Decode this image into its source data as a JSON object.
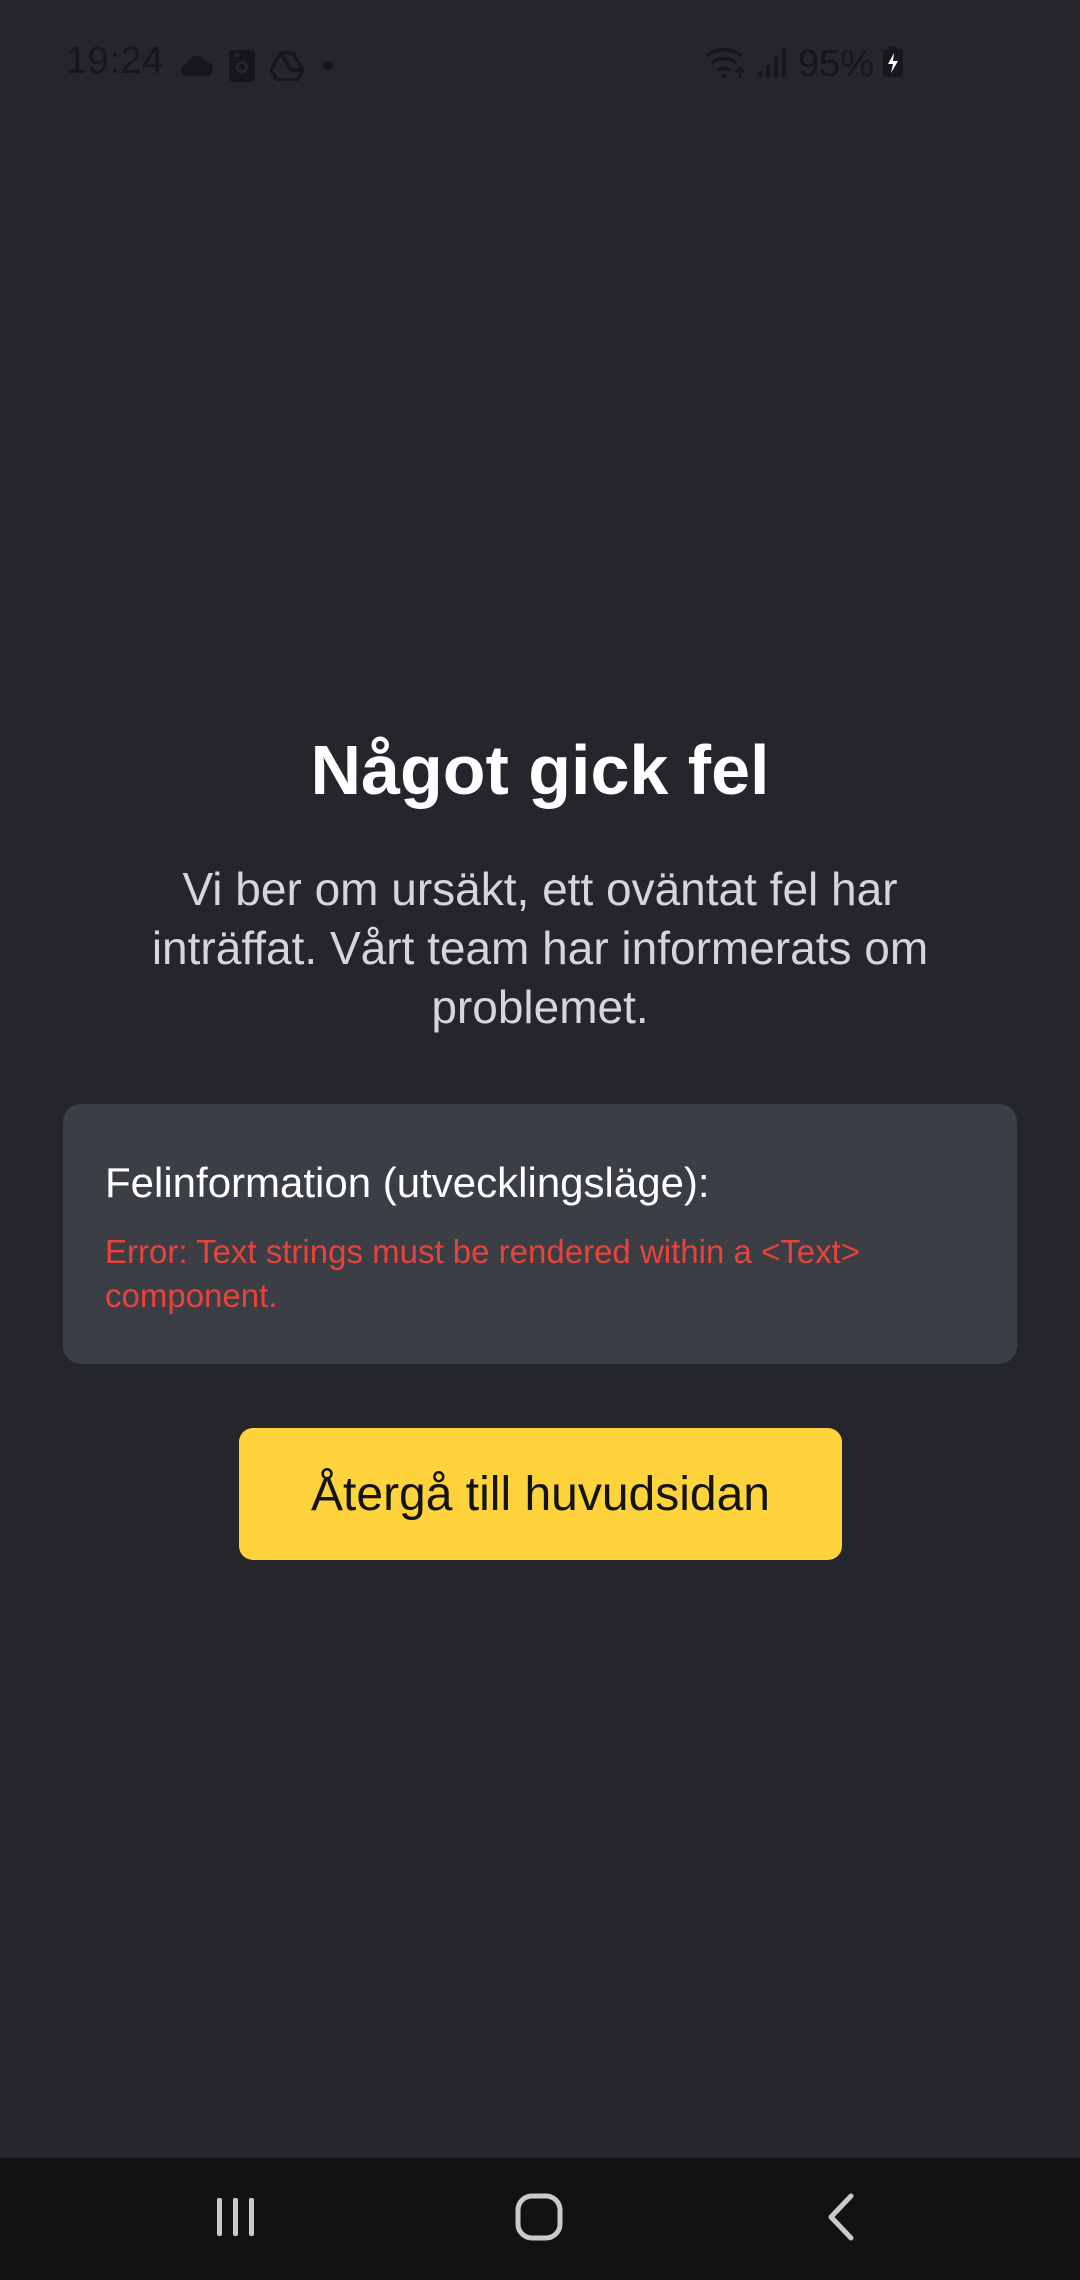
{
  "status_bar": {
    "time": "19:24",
    "left_icons": [
      "cloud-icon",
      "sim-card-icon",
      "drive-icon",
      "dot-icon"
    ],
    "right_icons": [
      "wifi-icon",
      "signal-icon",
      "battery-charging-icon"
    ],
    "battery": "95%"
  },
  "error_screen": {
    "title": "Något gick fel",
    "message": "Vi ber om ursäkt, ett oväntat fel har inträffat. Vårt team har informerats om problemet.",
    "details_heading": "Felinformation (utvecklingsläge):",
    "details_text": "Error: Text strings must be rendered within a <Text> component.",
    "home_button_label": "Återgå till huvudsidan"
  },
  "navigation": {
    "buttons": [
      "recent-apps-icon",
      "home-icon",
      "back-icon"
    ]
  },
  "colors": {
    "background": "#24262b",
    "card": "#3b3e44",
    "accent": "#fed33b",
    "error": "#e8433a",
    "nav_bar": "#111214"
  }
}
